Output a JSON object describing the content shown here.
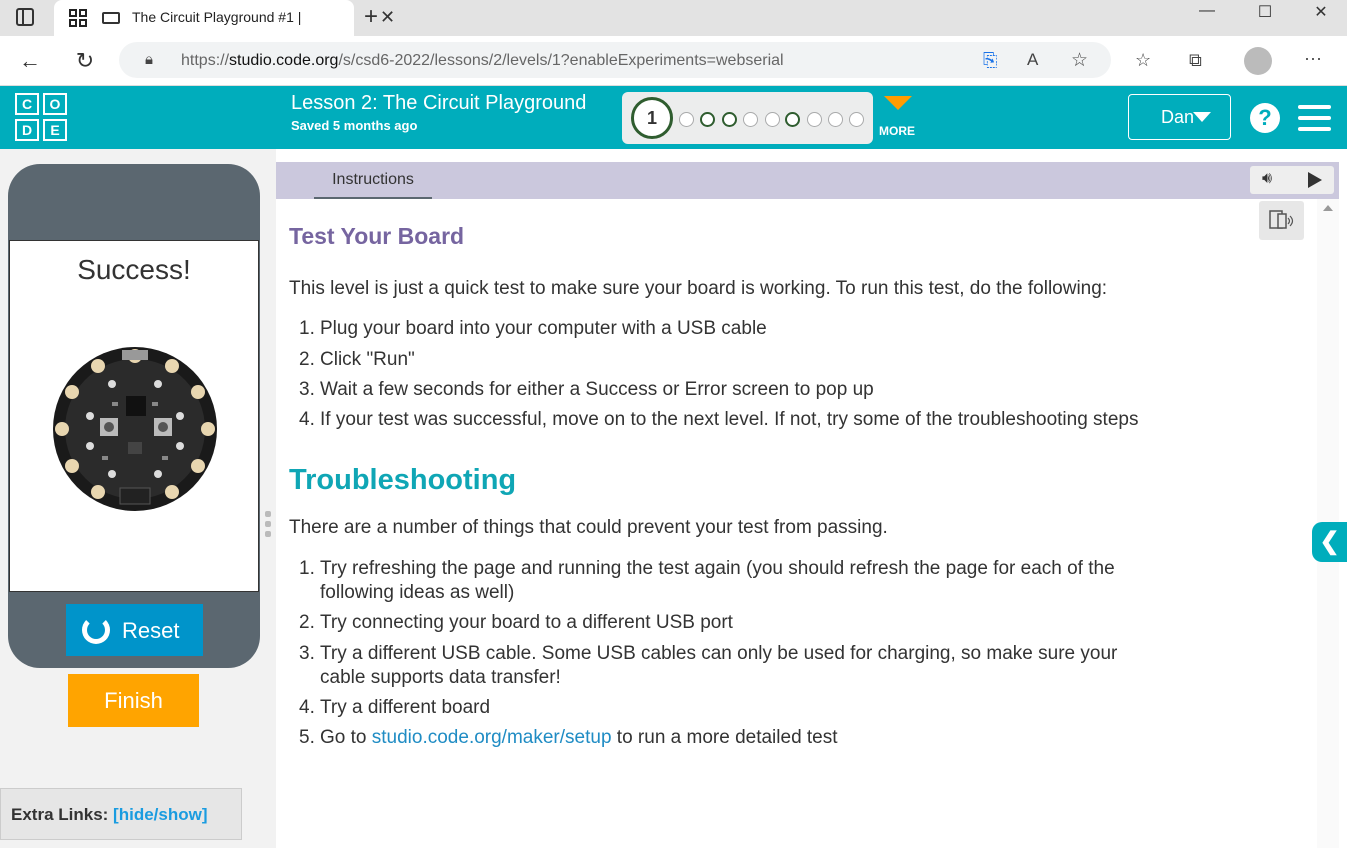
{
  "browser": {
    "tab_title": "The Circuit Playground #1 |",
    "url_prefix": "https://",
    "url_domain": "studio.code.org",
    "url_path": "/s/csd6-2022/lessons/2/levels/1?enableExperiments=webserial"
  },
  "header": {
    "logo_letters": [
      "C",
      "O",
      "D",
      "E"
    ],
    "lesson_title": "Lesson 2: The Circuit Playground",
    "saved_text": "Saved 5 months ago",
    "current_level": "1",
    "more_label": "MORE",
    "user_name": "Dan",
    "help_glyph": "?"
  },
  "progress": {
    "levels": [
      "empty",
      "done",
      "done",
      "empty",
      "empty",
      "done",
      "empty",
      "empty",
      "empty"
    ]
  },
  "left_panel": {
    "screen_message": "Success!",
    "reset_label": "Reset",
    "finish_label": "Finish",
    "extra_links_label": "Extra Links:",
    "extra_links_toggle": "[hide/show]"
  },
  "instructions": {
    "tab_label": "Instructions",
    "heading": "Test Your Board",
    "intro": "This level is just a quick test to make sure your board is working. To run this test, do the following:",
    "steps": [
      "Plug your board into your computer with a USB cable",
      "Click \"Run\"",
      "Wait a few seconds for either a Success or Error screen to pop up",
      "If your test was successful, move on to the next level. If not, try some of the troubleshooting steps"
    ],
    "trouble_heading": "Troubleshooting",
    "trouble_intro": "There are a number of things that could prevent your test from passing.",
    "trouble_steps": [
      "Try refreshing the page and running the test again (you should refresh the page for each of the",
      "following ideas as well)",
      "Try connecting your board to a different USB port",
      "Try a different USB cable. Some USB cables can only be used for charging, so make sure your",
      "cable supports data transfer!",
      "Try a different board",
      "Go to",
      "studio.code.org/maker/setup",
      "to run a more detailed test"
    ]
  },
  "colors": {
    "brand_teal": "#00adbc",
    "reset_blue": "#0094ca",
    "finish_orange": "#ffa400",
    "heading_purple": "#7665a0"
  }
}
